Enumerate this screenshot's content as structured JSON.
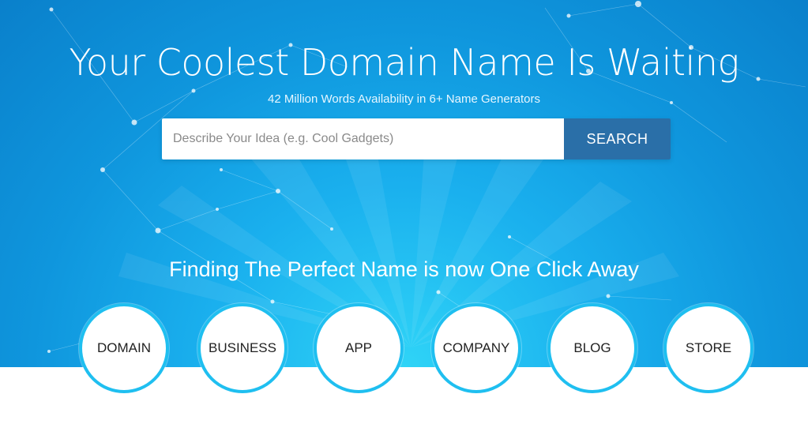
{
  "hero": {
    "headline": "Your Coolest Domain Name Is Waiting",
    "subheadline": "42 Million Words Availability in 6+ Name Generators"
  },
  "search": {
    "placeholder": "Describe Your Idea (e.g. Cool Gadgets)",
    "button_label": "SEARCH"
  },
  "tagline": "Finding The Perfect Name is now One Click Away",
  "categories": [
    {
      "label": "DOMAIN"
    },
    {
      "label": "BUSINESS"
    },
    {
      "label": "APP"
    },
    {
      "label": "COMPANY"
    },
    {
      "label": "BLOG"
    },
    {
      "label": "STORE"
    }
  ],
  "colors": {
    "hero_top": "#0a80cb",
    "hero_glow": "#2fd4f7",
    "search_button": "#2a6fa8",
    "circle_border": "#1fbff0"
  }
}
